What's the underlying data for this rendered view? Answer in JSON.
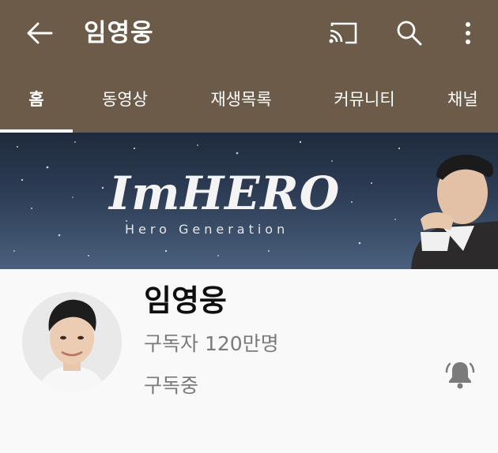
{
  "app": {
    "accent": "#6b5b48"
  },
  "header": {
    "title": "임영웅",
    "back_icon": "arrow-left-icon",
    "cast_icon": "cast-icon",
    "search_icon": "search-icon",
    "more_icon": "more-vert-icon"
  },
  "tabs": [
    {
      "label": "홈",
      "active": true
    },
    {
      "label": "동영상",
      "active": false
    },
    {
      "label": "재생목록",
      "active": false
    },
    {
      "label": "커뮤니티",
      "active": false
    },
    {
      "label": "채널",
      "active": false
    }
  ],
  "banner": {
    "title": "ImHERO",
    "subtitle": "Hero Generation"
  },
  "channel": {
    "name": "임영웅",
    "subscribers": "구독자 120만명",
    "subscribe_state": "구독중",
    "bell_icon": "bell-ringing-icon"
  }
}
